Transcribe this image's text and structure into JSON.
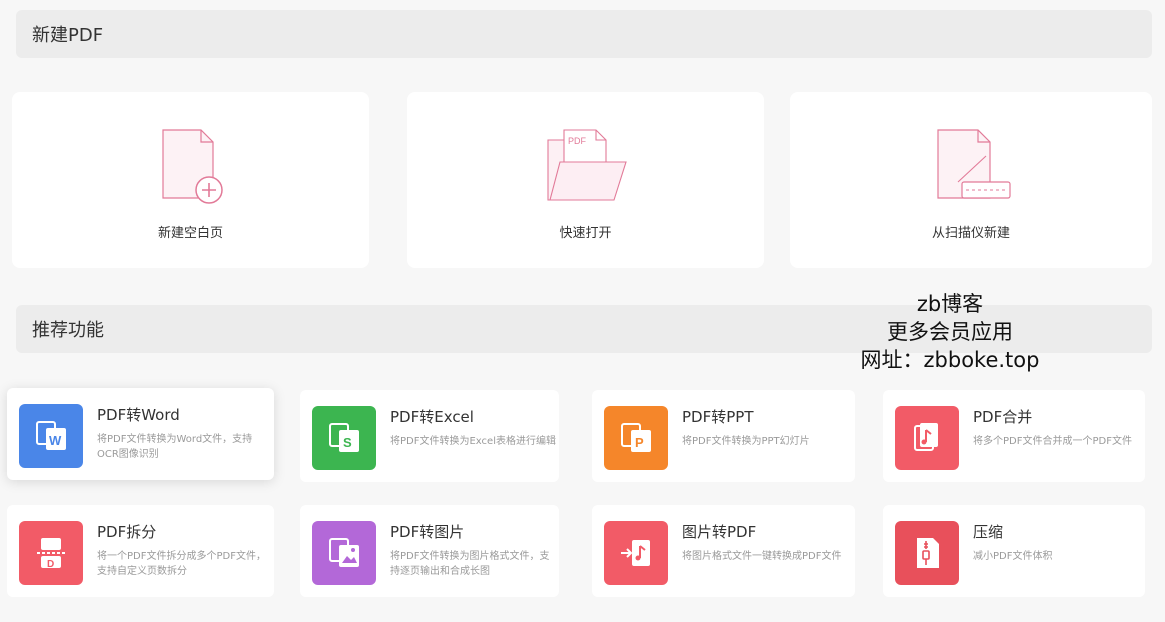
{
  "sections": {
    "new_pdf": "新建PDF",
    "recommended": "推荐功能"
  },
  "new_cards": [
    {
      "label": "新建空白页",
      "icon": "blank-page-plus-icon"
    },
    {
      "label": "快速打开",
      "icon": "open-folder-icon",
      "folder_tag": "PDF"
    },
    {
      "label": "从扫描仪新建",
      "icon": "scanner-page-icon"
    }
  ],
  "features": [
    {
      "title": "PDF转Word",
      "desc": "将PDF文件转换为Word文件，支持OCR图像识别",
      "icon": "pdf-to-word-icon",
      "color": "#4a86e8"
    },
    {
      "title": "PDF转Excel",
      "desc": "将PDF文件转换为Excel表格进行编辑",
      "icon": "pdf-to-excel-icon",
      "color": "#3cb550"
    },
    {
      "title": "PDF转PPT",
      "desc": "将PDF文件转换为PPT幻灯片",
      "icon": "pdf-to-ppt-icon",
      "color": "#f5862a"
    },
    {
      "title": "PDF合并",
      "desc": "将多个PDF文件合并成一个PDF文件",
      "icon": "pdf-merge-icon",
      "color": "#f25b67"
    },
    {
      "title": "PDF拆分",
      "desc": "将一个PDF文件拆分成多个PDF文件，支持自定义页数拆分",
      "icon": "pdf-split-icon",
      "color": "#f25b67"
    },
    {
      "title": "PDF转图片",
      "desc": "将PDF文件转换为图片格式文件，支持逐页输出和合成长图",
      "icon": "pdf-to-image-icon",
      "color": "#b368d8"
    },
    {
      "title": "图片转PDF",
      "desc": "将图片格式文件一键转换成PDF文件",
      "icon": "image-to-pdf-icon",
      "color": "#f25b67"
    },
    {
      "title": "压缩",
      "desc": "减小PDF文件体积",
      "icon": "compress-icon",
      "color": "#e8505b"
    }
  ],
  "watermark": {
    "line1": "zb博客",
    "line2": "更多会员应用",
    "line3": "网址：zbboke.top"
  }
}
